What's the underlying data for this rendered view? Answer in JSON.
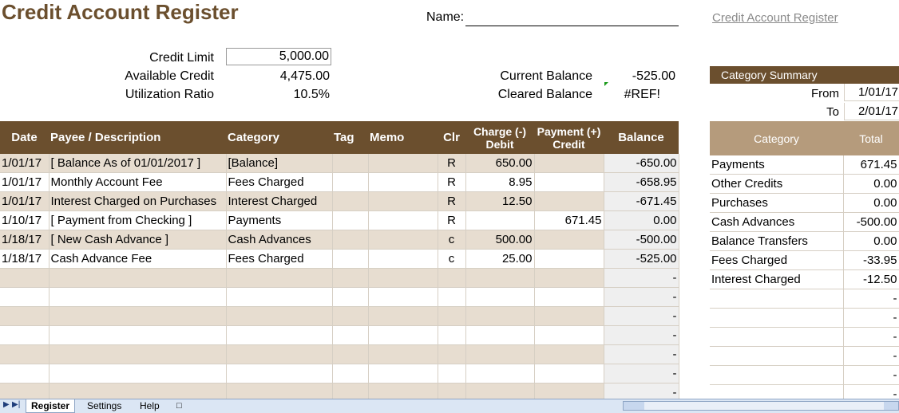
{
  "header": {
    "title": "Credit Account Register",
    "name_label": "Name:",
    "link_text": "Credit Account Register"
  },
  "summary_fields": {
    "credit_limit_label": "Credit Limit",
    "credit_limit_value": "5,000.00",
    "available_credit_label": "Available Credit",
    "available_credit_value": "4,475.00",
    "utilization_label": "Utilization Ratio",
    "utilization_value": "10.5%",
    "current_balance_label": "Current Balance",
    "current_balance_value": "-525.00",
    "cleared_balance_label": "Cleared Balance",
    "cleared_balance_value": "#REF!"
  },
  "register": {
    "headers": {
      "date": "Date",
      "payee": "Payee / Description",
      "category": "Category",
      "tag": "Tag",
      "memo": "Memo",
      "clr": "Clr",
      "charge_1": "Charge (-)",
      "charge_2": "Debit",
      "payment_1": "Payment (+)",
      "payment_2": "Credit",
      "balance": "Balance"
    },
    "rows": [
      {
        "date": "1/01/17",
        "payee": "[ Balance As of 01/01/2017 ]",
        "category": "[Balance]",
        "tag": "",
        "memo": "",
        "clr": "R",
        "charge": "650.00",
        "payment": "",
        "balance": "-650.00"
      },
      {
        "date": "1/01/17",
        "payee": "Monthly Account Fee",
        "category": "Fees Charged",
        "tag": "",
        "memo": "",
        "clr": "R",
        "charge": "8.95",
        "payment": "",
        "balance": "-658.95"
      },
      {
        "date": "1/01/17",
        "payee": "Interest Charged on Purchases",
        "category": "Interest Charged",
        "tag": "",
        "memo": "",
        "clr": "R",
        "charge": "12.50",
        "payment": "",
        "balance": "-671.45"
      },
      {
        "date": "1/10/17",
        "payee": "[ Payment from Checking ]",
        "category": "Payments",
        "tag": "",
        "memo": "",
        "clr": "R",
        "charge": "",
        "payment": "671.45",
        "balance": "0.00"
      },
      {
        "date": "1/18/17",
        "payee": "[ New Cash Advance ]",
        "category": "Cash Advances",
        "tag": "",
        "memo": "",
        "clr": "c",
        "charge": "500.00",
        "payment": "",
        "balance": "-500.00"
      },
      {
        "date": "1/18/17",
        "payee": "Cash Advance Fee",
        "category": "Fees Charged",
        "tag": "",
        "memo": "",
        "clr": "c",
        "charge": "25.00",
        "payment": "",
        "balance": "-525.00"
      },
      {
        "date": "",
        "payee": "",
        "category": "",
        "tag": "",
        "memo": "",
        "clr": "",
        "charge": "",
        "payment": "",
        "balance": "-"
      },
      {
        "date": "",
        "payee": "",
        "category": "",
        "tag": "",
        "memo": "",
        "clr": "",
        "charge": "",
        "payment": "",
        "balance": "-"
      },
      {
        "date": "",
        "payee": "",
        "category": "",
        "tag": "",
        "memo": "",
        "clr": "",
        "charge": "",
        "payment": "",
        "balance": "-"
      },
      {
        "date": "",
        "payee": "",
        "category": "",
        "tag": "",
        "memo": "",
        "clr": "",
        "charge": "",
        "payment": "",
        "balance": "-"
      },
      {
        "date": "",
        "payee": "",
        "category": "",
        "tag": "",
        "memo": "",
        "clr": "",
        "charge": "",
        "payment": "",
        "balance": "-"
      },
      {
        "date": "",
        "payee": "",
        "category": "",
        "tag": "",
        "memo": "",
        "clr": "",
        "charge": "",
        "payment": "",
        "balance": "-"
      },
      {
        "date": "",
        "payee": "",
        "category": "",
        "tag": "",
        "memo": "",
        "clr": "",
        "charge": "",
        "payment": "",
        "balance": "-"
      }
    ]
  },
  "category_summary": {
    "title": "Category Summary",
    "from_label": "From",
    "from_value": "1/01/17",
    "to_label": "To",
    "to_value": "2/01/17",
    "col_category": "Category",
    "col_total": "Total",
    "rows": [
      {
        "category": "Payments",
        "total": "671.45"
      },
      {
        "category": "Other Credits",
        "total": "0.00"
      },
      {
        "category": "Purchases",
        "total": "0.00"
      },
      {
        "category": "Cash Advances",
        "total": "-500.00"
      },
      {
        "category": "Balance Transfers",
        "total": "0.00"
      },
      {
        "category": "Fees Charged",
        "total": "-33.95"
      },
      {
        "category": "Interest Charged",
        "total": "-12.50"
      },
      {
        "category": "",
        "total": "-"
      },
      {
        "category": "",
        "total": "-"
      },
      {
        "category": "",
        "total": "-"
      },
      {
        "category": "",
        "total": "-"
      },
      {
        "category": "",
        "total": "-"
      },
      {
        "category": "",
        "total": "-"
      }
    ]
  },
  "sheet_tabs": {
    "register": "Register",
    "settings": "Settings",
    "help": "Help"
  },
  "colors": {
    "brand_brown": "#6b4f2e",
    "summary_header_tan": "#b59b7c",
    "row_shade": "#e7ddd0"
  }
}
